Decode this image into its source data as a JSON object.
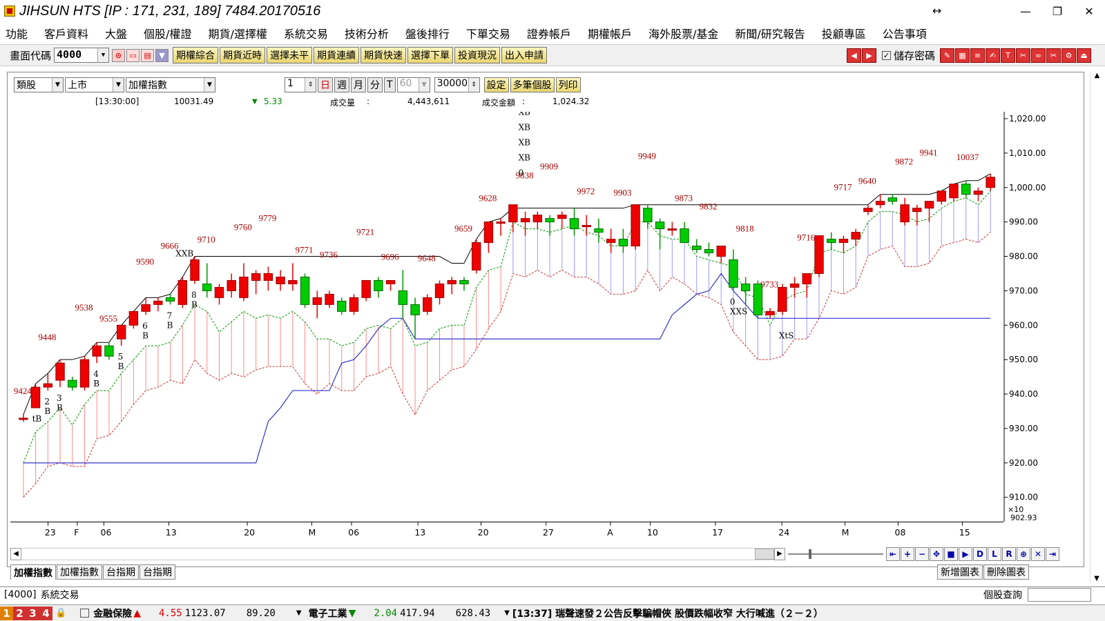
{
  "window": {
    "title": "JIHSUN HTS    [IP : 171, 231, 189] 7484.20170516"
  },
  "menu": [
    "功能",
    "客戶資料",
    "大盤",
    "個股/權證",
    "期貨/選擇權",
    "系統交易",
    "技術分析",
    "盤後排行",
    "下單交易",
    "證券帳戶",
    "期權帳戶",
    "海外股票/基金",
    "新聞/研究報告",
    "投顧專區",
    "公告事項"
  ],
  "toolbar": {
    "code_label": "畫面代碼",
    "code_value": "4000",
    "buttons": [
      "期權綜合",
      "期貨近時",
      "選擇未平",
      "期貨連續",
      "期貨快速",
      "選擇下單",
      "投資現況",
      "出入申請"
    ],
    "save_pwd": "儲存密碼"
  },
  "controls": {
    "category": "類股",
    "market": "上市",
    "index": "加權指數",
    "num": "1",
    "periods": [
      "日",
      "週",
      "月",
      "分",
      "T"
    ],
    "period60": "60",
    "count": "30000",
    "buttons": [
      "設定",
      "多筆個股",
      "列印"
    ]
  },
  "info": {
    "time": "[13:30:00]",
    "price": "10031.49",
    "change": "5.33",
    "vol_label": "成交量",
    "vol_sep": ":",
    "volume": "4,443,611",
    "amt_label": "成交金額",
    "amt_sep": ":",
    "amount": "1,024.32"
  },
  "chart_data": {
    "type": "candlestick",
    "ylim": [
      902.93,
      1022
    ],
    "y_ticks": [
      910,
      920,
      930,
      940,
      950,
      960,
      970,
      980,
      990,
      1000,
      1010,
      1020
    ],
    "y_tick_labels": [
      "910.00",
      "920.00",
      "930.00",
      "940.00",
      "950.00",
      "960.00",
      "970.00",
      "980.00",
      "990.00",
      "1,000.00",
      "1,010.00",
      "1,020.00"
    ],
    "axis_extra": [
      "×10",
      "902.93"
    ],
    "x_labels": [
      "23",
      "F",
      "06",
      "13",
      "20",
      "M",
      "06",
      "13",
      "20",
      "27",
      "A",
      "10",
      "17",
      "24",
      "M",
      "08",
      "15"
    ],
    "candles": [
      [
        933,
        934,
        932,
        933
      ],
      [
        936,
        943,
        936,
        942
      ],
      [
        942,
        946,
        941,
        943
      ],
      [
        944,
        950,
        942,
        949
      ],
      [
        944,
        945,
        941,
        942
      ],
      [
        942,
        951,
        941,
        950
      ],
      [
        951,
        955,
        949,
        954
      ],
      [
        954,
        955,
        950,
        951
      ],
      [
        956,
        960,
        954,
        960
      ],
      [
        960,
        964,
        959,
        964
      ],
      [
        964,
        968,
        963,
        966
      ],
      [
        966,
        968,
        964,
        967
      ],
      [
        968,
        969,
        966,
        967
      ],
      [
        966,
        974,
        965,
        973
      ],
      [
        973,
        980,
        972,
        979
      ],
      [
        972,
        978,
        968,
        970
      ],
      [
        968,
        972,
        966,
        971
      ],
      [
        970,
        975,
        968,
        973
      ],
      [
        968,
        978,
        967,
        974
      ],
      [
        973,
        976,
        969,
        975
      ],
      [
        973,
        977,
        970,
        975
      ],
      [
        972,
        976,
        970,
        974
      ],
      [
        972,
        978,
        970,
        973
      ],
      [
        974,
        975,
        965,
        966
      ],
      [
        966,
        970,
        962,
        968
      ],
      [
        966,
        970,
        965,
        969
      ],
      [
        967,
        968,
        963,
        964
      ],
      [
        964,
        969,
        963,
        968
      ],
      [
        968,
        973,
        967,
        973
      ],
      [
        973,
        974,
        968,
        970
      ],
      [
        972,
        973,
        970,
        973
      ],
      [
        970,
        976,
        962,
        966
      ],
      [
        966,
        968,
        956,
        963
      ],
      [
        964,
        969,
        963,
        968
      ],
      [
        968,
        973,
        966,
        972
      ],
      [
        972,
        974,
        969,
        973
      ],
      [
        973,
        974,
        970,
        972
      ],
      [
        976,
        985,
        975,
        984
      ],
      [
        984,
        990,
        981,
        990
      ],
      [
        990,
        991,
        986,
        990
      ],
      [
        990,
        994,
        987,
        995
      ],
      [
        990,
        993,
        986,
        991
      ],
      [
        990,
        993,
        988,
        992
      ],
      [
        991,
        992,
        986,
        990
      ],
      [
        991,
        993,
        988,
        992
      ],
      [
        991,
        994,
        986,
        988
      ],
      [
        989,
        992,
        986,
        989
      ],
      [
        988,
        991,
        984,
        987
      ],
      [
        984,
        988,
        981,
        985
      ],
      [
        985,
        988,
        981,
        983
      ],
      [
        983,
        995,
        982,
        995
      ],
      [
        994,
        995,
        988,
        990
      ],
      [
        990,
        991,
        982,
        988
      ],
      [
        988,
        990,
        986,
        988
      ],
      [
        988,
        990,
        984,
        984
      ],
      [
        983,
        985,
        981,
        982
      ],
      [
        982,
        984,
        980,
        981
      ],
      [
        980,
        983,
        978,
        983
      ],
      [
        979,
        982,
        970,
        971
      ],
      [
        972,
        974,
        966,
        970
      ],
      [
        972,
        973,
        962,
        963
      ],
      [
        963,
        965,
        962,
        964
      ],
      [
        964,
        972,
        963,
        971
      ],
      [
        971,
        974,
        968,
        972
      ],
      [
        972,
        975,
        968,
        975
      ],
      [
        975,
        986,
        974,
        986
      ],
      [
        985,
        987,
        982,
        984
      ],
      [
        984,
        986,
        981,
        985
      ],
      [
        985,
        988,
        983,
        987
      ],
      [
        993,
        995,
        992,
        994
      ],
      [
        995,
        998,
        994,
        996
      ],
      [
        997,
        998,
        995,
        996
      ],
      [
        990,
        997,
        989,
        995
      ],
      [
        993,
        995,
        989,
        994
      ],
      [
        994,
        996,
        990,
        996
      ],
      [
        996,
        999,
        995,
        999
      ],
      [
        997,
        1001,
        996,
        1001
      ],
      [
        1001,
        1002,
        997,
        998
      ],
      [
        998,
        1000,
        996,
        999
      ],
      [
        1000,
        1004,
        999,
        1003
      ]
    ],
    "annotations_red": [
      "9424",
      "9448",
      "9538",
      "9555",
      "9590",
      "9666",
      "9710",
      "9760",
      "9779",
      "9771",
      "9736",
      "9721",
      "9696",
      "9648",
      "9659",
      "9628",
      "9838",
      "9909",
      "9972",
      "9903",
      "9949",
      "9873",
      "9832",
      "9818",
      "9733",
      "9716",
      "9717",
      "9640",
      "9872",
      "9941",
      "10037"
    ],
    "signals_top": [
      "XXB",
      "0",
      "XB",
      "XB",
      "XB",
      "XB"
    ],
    "signals_bottom": [
      "tB",
      "B",
      "2",
      "B",
      "3",
      "B",
      "4",
      "B",
      "5",
      "B",
      "6",
      "B",
      "7",
      "B",
      "8",
      "XXS",
      "0",
      "XtS"
    ]
  },
  "tabs": [
    "加權指數",
    "加權指數",
    "台指期",
    "台指期"
  ],
  "tab_buttons": [
    "新增圖表",
    "刪除圖表"
  ],
  "bottom_tab": {
    "code": "[4000]",
    "name": "系統交易",
    "right": "個股查詢"
  },
  "status": {
    "nums": [
      "1",
      "2",
      "3",
      "4"
    ],
    "sector1": "金融保險",
    "arr1": "▲",
    "val1": "4.55",
    "val1b": "1123.07",
    "val1c": "89.20",
    "sector2": "電子工業",
    "arr2": "▼",
    "val2": "2.04",
    "val2b": "417.94",
    "val2c": "628.43",
    "news": "[13:37] 瑞聲速發２公告反擊騙帽俠 股價跌幅收窄 大行喊進（２－２）"
  }
}
